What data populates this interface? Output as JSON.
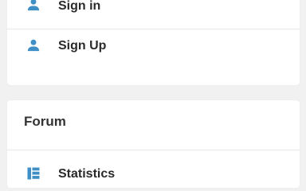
{
  "colors": {
    "icon": "#3d8fc6",
    "background": "#f1f1f1",
    "card": "#ffffff"
  },
  "auth_menu": {
    "items": [
      {
        "label": "Sign in",
        "icon": "user-icon"
      },
      {
        "label": "Sign Up",
        "icon": "user-icon"
      }
    ]
  },
  "forum": {
    "title": "Forum",
    "items": [
      {
        "label": "Statistics",
        "icon": "statistics-icon"
      }
    ]
  }
}
